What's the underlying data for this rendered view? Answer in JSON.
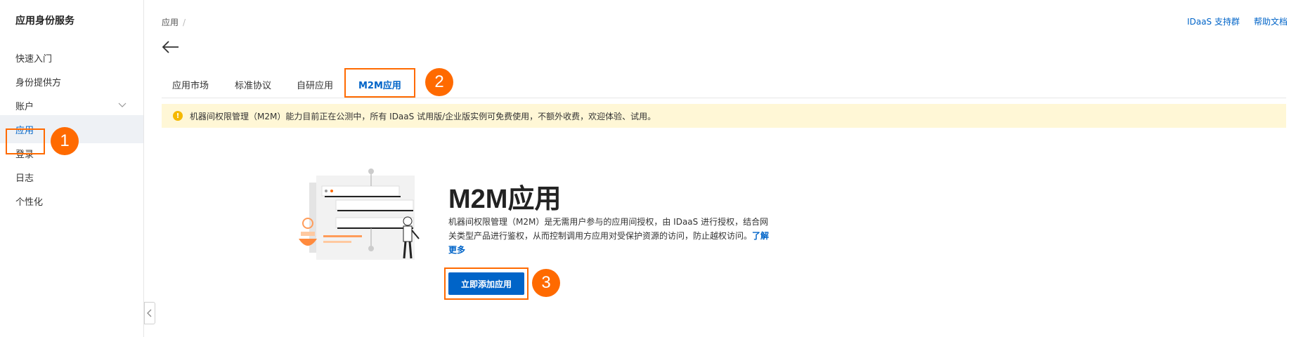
{
  "sidebar": {
    "title": "应用身份服务",
    "items": [
      {
        "label": "快速入门"
      },
      {
        "label": "身份提供方"
      },
      {
        "label": "账户"
      },
      {
        "label": "应用"
      },
      {
        "label": "登录"
      },
      {
        "label": "日志"
      },
      {
        "label": "个性化"
      }
    ],
    "active_item": "应用"
  },
  "breadcrumb": {
    "item": "应用",
    "separator": "/"
  },
  "header_links": {
    "support_group": "IDaaS 支持群",
    "help_docs": "帮助文档"
  },
  "tabs": [
    {
      "label": "应用市场"
    },
    {
      "label": "标准协议"
    },
    {
      "label": "自研应用"
    },
    {
      "label": "M2M应用"
    }
  ],
  "active_tab": "M2M应用",
  "notice": {
    "text": "机器间权限管理（M2M）能力目前正在公测中，所有 IDaaS 试用版/企业版实例可免费使用，不额外收费，欢迎体验、试用。"
  },
  "hero": {
    "title": "M2M应用",
    "description": "机器间权限管理（M2M）是无需用户参与的应用间授权，由 IDaaS 进行授权，结合网关类型产品进行鉴权，从而控制调用方应用对受保护资源的访问，防止越权访问。",
    "learn_more": "了解更多",
    "cta_label": "立即添加应用"
  },
  "step_badges": [
    "1",
    "2",
    "3"
  ],
  "colors": {
    "primary": "#0064c8",
    "highlight": "#ff6a00",
    "notice_bg": "#fff7d6",
    "warn": "#f5b800"
  },
  "icons": [
    "back-arrow-icon",
    "chevron-down-icon",
    "collapse-left-icon",
    "warning-icon"
  ]
}
